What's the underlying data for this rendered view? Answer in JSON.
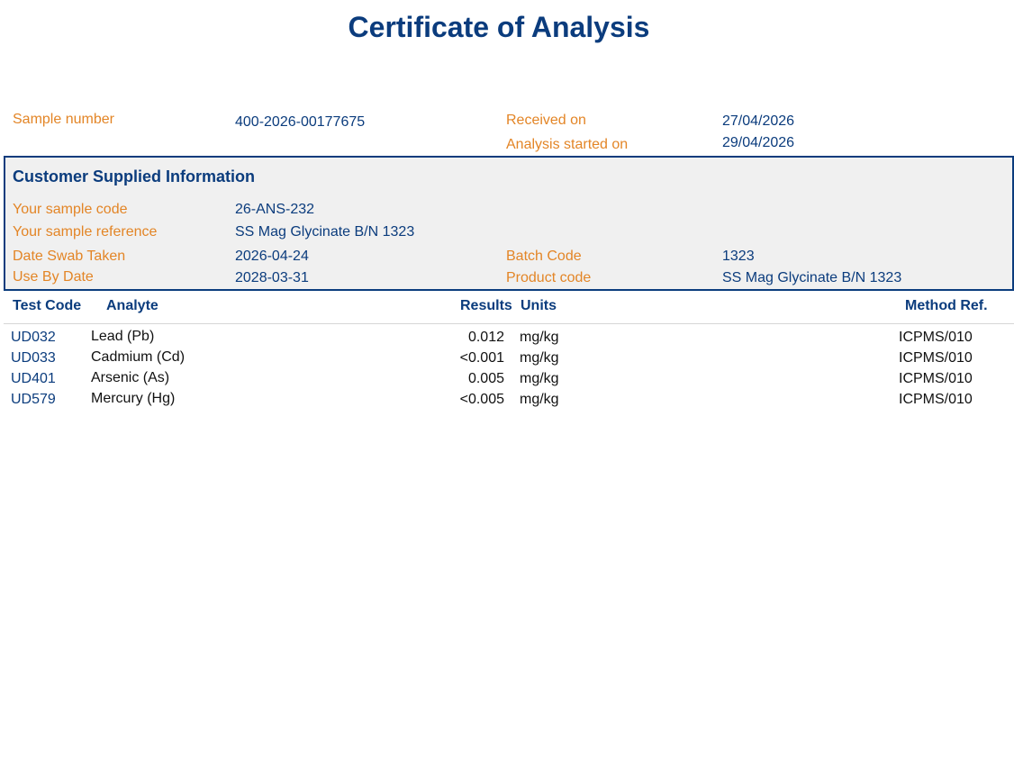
{
  "document": {
    "title": "Certificate of Analysis"
  },
  "sample_info": {
    "sample_number_label": "Sample number",
    "sample_number": "400-2026-00177675",
    "received_on_label": "Received on",
    "received_on": "27/04/2026",
    "analysis_started_label": "Analysis started on",
    "analysis_started": "29/04/2026"
  },
  "customer_info": {
    "heading": "Customer Supplied Information",
    "sample_code_label": "Your sample code",
    "sample_code": "26-ANS-232",
    "sample_reference_label": "Your sample reference",
    "sample_reference": "SS Mag Glycinate B/N 1323",
    "date_swab_label": "Date Swab Taken",
    "date_swab": "2026-04-24",
    "batch_code_label": "Batch Code",
    "batch_code": "1323",
    "use_by_label": "Use By Date",
    "use_by": "2028-03-31",
    "product_code_label": "Product code",
    "product_code": "SS Mag Glycinate B/N 1323"
  },
  "results_table": {
    "headers": {
      "test_code": "Test Code",
      "analyte": "Analyte",
      "results": "Results",
      "units": "Units",
      "method_ref": "Method Ref."
    },
    "rows": [
      {
        "test_code": "UD032",
        "analyte": "Lead (Pb)",
        "result": "0.012",
        "units": "mg/kg",
        "method": "ICPMS/010"
      },
      {
        "test_code": "UD033",
        "analyte": "Cadmium (Cd)",
        "result": "<0.001",
        "units": "mg/kg",
        "method": "ICPMS/010"
      },
      {
        "test_code": "UD401",
        "analyte": "Arsenic (As)",
        "result": "0.005",
        "units": "mg/kg",
        "method": "ICPMS/010"
      },
      {
        "test_code": "UD579",
        "analyte": "Mercury (Hg)",
        "result": "<0.005",
        "units": "mg/kg",
        "method": "ICPMS/010"
      }
    ]
  },
  "colors": {
    "heading_blue": "#0b3c7d",
    "label_orange": "#e38526",
    "box_background": "#f0f0f0"
  }
}
